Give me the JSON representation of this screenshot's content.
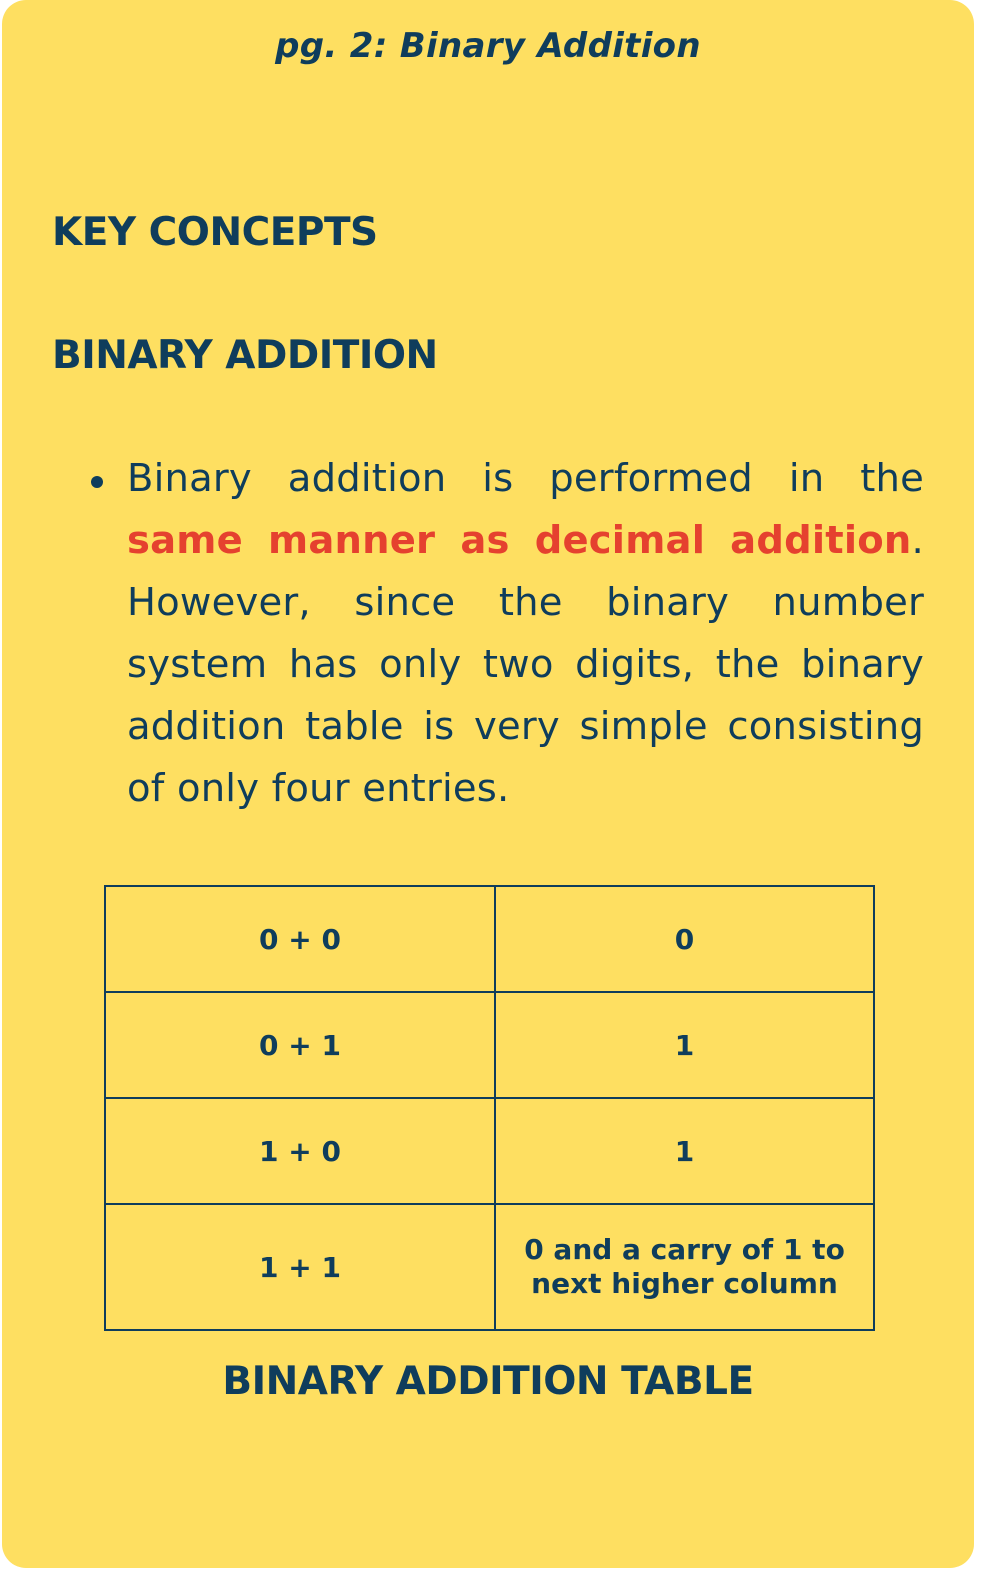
{
  "page_label": "pg. 2: Binary Addition",
  "headings": {
    "key_concepts": "KEY CONCEPTS",
    "binary_addition": "BINARY ADDITION"
  },
  "bullet": {
    "text_before": "Binary addition is performed in the ",
    "emphasis": "same manner as decimal addition",
    "text_after": ". However, since the binary number system has only two digits, the binary addition table is very simple consisting of only four entries."
  },
  "table": {
    "rows": [
      {
        "expression": "0 + 0",
        "result": "0"
      },
      {
        "expression": "0 + 1",
        "result": "1"
      },
      {
        "expression": "1 + 0",
        "result": "1"
      },
      {
        "expression": "1 + 1",
        "result": "0 and a carry of 1 to next higher column"
      }
    ],
    "result_line_1": "0 and a carry of 1 to",
    "result_line_2": "next higher column"
  },
  "caption": "BINARY ADDITION TABLE",
  "colors": {
    "background": "#fedf61",
    "text": "#0f3d5c",
    "emphasis": "#e5412f"
  }
}
